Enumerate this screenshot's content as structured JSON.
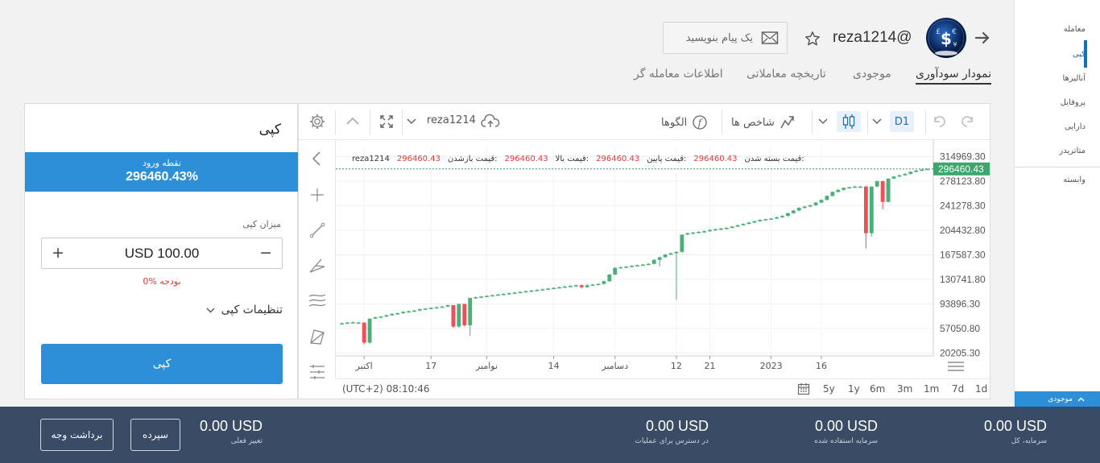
{
  "sidebar": {
    "items": [
      {
        "label": "معامله"
      },
      {
        "label": "کپی"
      },
      {
        "label": "آنالیزها"
      },
      {
        "label": "پروفایل"
      },
      {
        "label": "دارایی"
      },
      {
        "label": "متاتریدر"
      },
      {
        "label": "وابسته"
      }
    ],
    "footer_label": "موجودی"
  },
  "header": {
    "username": "reza1214@",
    "message_placeholder": "یک پیام بنویسید"
  },
  "tabs": [
    {
      "label": "نمودار سودآوری"
    },
    {
      "label": "موجودی"
    },
    {
      "label": "تاریخچه معاملاتی"
    },
    {
      "label": "اطلاعات معامله گر"
    }
  ],
  "copy_panel": {
    "title": "کپی",
    "entry_label": "نقطه ورود",
    "entry_value": "296460.43%",
    "amount_label": "میزان کپی",
    "amount_value": "USD 100.00",
    "plus": "+",
    "minus": "−",
    "budget": "0% بودجه",
    "settings_label": "تنظیمات کپی",
    "copy_button": "کپی"
  },
  "chart_toolbar": {
    "interval": "D1",
    "indicators": "شاخص ها",
    "patterns": "الگوها",
    "symbol": "reza1214"
  },
  "legend": {
    "symbol": "reza1214",
    "open_label": "قیمت بازشدن:",
    "open_value": "296460.43",
    "high_label": "قیمت بالا:",
    "high_value": "296460.43",
    "low_label": "قیمت پایین:",
    "low_value": "296460.43",
    "close_label": "قیمت بسته شدن:",
    "close_value": "296460.43"
  },
  "chart_bottom": {
    "time": "(UTC+2) 08:10:46",
    "timeframes": [
      "5y",
      "1y",
      "6m",
      "3m",
      "1m",
      "7d",
      "1d"
    ]
  },
  "chart_data": {
    "type": "candlestick",
    "y_ticks": [
      "314969.30",
      "278123.80",
      "241278.30",
      "204432.80",
      "167587.30",
      "130741.80",
      "93896.30",
      "57050.80",
      "20205.30"
    ],
    "y_tick_values": [
      314969.3,
      278123.8,
      241278.3,
      204432.8,
      167587.3,
      130741.8,
      93896.3,
      57050.8,
      20205.3
    ],
    "ylim": [
      16000,
      330000
    ],
    "x_ticks": [
      "اکتبر",
      "17",
      "نوامبر",
      "14",
      "دسامبر",
      "12",
      "21",
      "2023",
      "16"
    ],
    "last_price": "296460.43",
    "last_value": 296460.43,
    "colors": {
      "up": "#4caf78",
      "down": "#ef4f56",
      "last": "#3aa76d"
    },
    "candles": [
      [
        65000,
        65000,
        66000,
        64000
      ],
      [
        65000,
        66000,
        67000,
        64000
      ],
      [
        66000,
        66500,
        67500,
        65000
      ],
      [
        66000,
        66000,
        67000,
        65500
      ],
      [
        66000,
        36000,
        66000,
        33000
      ],
      [
        36000,
        72000,
        72000,
        34000
      ],
      [
        72000,
        74000,
        75000,
        71000
      ],
      [
        74000,
        75000,
        76000,
        73000
      ],
      [
        75000,
        77000,
        78000,
        74000
      ],
      [
        77000,
        79000,
        80000,
        76000
      ],
      [
        79000,
        80000,
        81000,
        78000
      ],
      [
        80000,
        82000,
        83000,
        79000
      ],
      [
        82000,
        83000,
        84000,
        81000
      ],
      [
        83000,
        84000,
        85000,
        82000
      ],
      [
        84000,
        86000,
        87000,
        83000
      ],
      [
        86000,
        87000,
        88000,
        85000
      ],
      [
        87000,
        88000,
        89000,
        86000
      ],
      [
        88000,
        89000,
        90000,
        87000
      ],
      [
        89000,
        90000,
        91000,
        88000
      ],
      [
        90000,
        92000,
        93000,
        89000
      ],
      [
        92000,
        60000,
        92000,
        58000
      ],
      [
        60000,
        94000,
        94000,
        58000
      ],
      [
        94000,
        62000,
        94000,
        60000
      ],
      [
        62000,
        103000,
        103000,
        46000
      ],
      [
        103000,
        104000,
        105000,
        102000
      ],
      [
        104000,
        105000,
        106000,
        103000
      ],
      [
        105000,
        106000,
        107000,
        104000
      ],
      [
        106000,
        107000,
        108000,
        105000
      ],
      [
        107000,
        108000,
        109000,
        106000
      ],
      [
        108000,
        109000,
        110000,
        107000
      ],
      [
        109000,
        110000,
        111000,
        108000
      ],
      [
        110000,
        111000,
        112000,
        109000
      ],
      [
        111000,
        112000,
        113000,
        110000
      ],
      [
        112000,
        113000,
        114000,
        111000
      ],
      [
        113000,
        114000,
        115000,
        112000
      ],
      [
        114000,
        115000,
        116000,
        113000
      ],
      [
        115000,
        116000,
        117000,
        114000
      ],
      [
        116000,
        117000,
        118000,
        115000
      ],
      [
        117000,
        118000,
        119000,
        116000
      ],
      [
        118000,
        119000,
        120000,
        117000
      ],
      [
        119000,
        120000,
        121000,
        118000
      ],
      [
        120000,
        121000,
        122000,
        119000
      ],
      [
        121000,
        122000,
        123000,
        120000
      ],
      [
        122000,
        119000,
        123000,
        117000
      ],
      [
        119000,
        122000,
        124000,
        118000
      ],
      [
        122000,
        123000,
        124000,
        121000
      ],
      [
        123000,
        124000,
        125000,
        122000
      ],
      [
        124000,
        128000,
        129000,
        123000
      ],
      [
        128000,
        138000,
        139000,
        127000
      ],
      [
        138000,
        148000,
        149000,
        137000
      ],
      [
        148000,
        149000,
        150000,
        147000
      ],
      [
        149000,
        150000,
        151000,
        148000
      ],
      [
        150000,
        151000,
        152000,
        149000
      ],
      [
        151000,
        152000,
        153000,
        150000
      ],
      [
        152000,
        153000,
        154000,
        151000
      ],
      [
        153000,
        154000,
        155000,
        152000
      ],
      [
        154000,
        160000,
        161000,
        153000
      ],
      [
        160000,
        164000,
        165000,
        150000
      ],
      [
        164000,
        168000,
        169000,
        163000
      ],
      [
        168000,
        170000,
        171000,
        167000
      ],
      [
        170000,
        172000,
        173000,
        100000
      ],
      [
        172000,
        198000,
        198000,
        171000
      ],
      [
        198000,
        200000,
        201000,
        197000
      ],
      [
        200000,
        201000,
        202000,
        199000
      ],
      [
        201000,
        202000,
        203000,
        200000
      ],
      [
        202000,
        203000,
        204000,
        201000
      ],
      [
        203000,
        205000,
        206000,
        202000
      ],
      [
        205000,
        206000,
        207000,
        204000
      ],
      [
        206000,
        207000,
        208000,
        205000
      ],
      [
        207000,
        208000,
        209000,
        206000
      ],
      [
        208000,
        210000,
        211000,
        207000
      ],
      [
        210000,
        212000,
        213000,
        209000
      ],
      [
        212000,
        214000,
        215000,
        211000
      ],
      [
        214000,
        216000,
        217000,
        213000
      ],
      [
        216000,
        218000,
        219000,
        215000
      ],
      [
        218000,
        220000,
        221000,
        217000
      ],
      [
        220000,
        221000,
        222000,
        219000
      ],
      [
        221000,
        222000,
        223000,
        220000
      ],
      [
        222000,
        224000,
        225000,
        221000
      ],
      [
        224000,
        226000,
        227000,
        223000
      ],
      [
        226000,
        230000,
        231000,
        225000
      ],
      [
        230000,
        234000,
        235000,
        229000
      ],
      [
        234000,
        238000,
        239000,
        233000
      ],
      [
        238000,
        240000,
        241000,
        237000
      ],
      [
        240000,
        242000,
        243000,
        239000
      ],
      [
        242000,
        246000,
        247000,
        241000
      ],
      [
        246000,
        250000,
        251000,
        245000
      ],
      [
        250000,
        256000,
        257000,
        249000
      ],
      [
        256000,
        262000,
        263000,
        255000
      ],
      [
        262000,
        265000,
        266000,
        261000
      ],
      [
        265000,
        268000,
        269000,
        264000
      ],
      [
        268000,
        269000,
        270000,
        267000
      ],
      [
        269000,
        270000,
        271000,
        268000
      ],
      [
        270000,
        270000,
        271000,
        269000
      ],
      [
        270000,
        200000,
        271000,
        177000
      ],
      [
        200000,
        270000,
        270000,
        195000
      ],
      [
        270000,
        278000,
        279000,
        269000
      ],
      [
        278000,
        247000,
        279000,
        236000
      ],
      [
        247000,
        282000,
        282000,
        246000
      ],
      [
        282000,
        285000,
        286000,
        281000
      ],
      [
        285000,
        287000,
        288000,
        284000
      ],
      [
        287000,
        289000,
        290000,
        286000
      ],
      [
        289000,
        292000,
        293000,
        288000
      ],
      [
        292000,
        294000,
        295000,
        291000
      ],
      [
        294000,
        295500,
        296000,
        293000
      ],
      [
        295500,
        296460.43,
        297000,
        295000
      ]
    ]
  }
}
